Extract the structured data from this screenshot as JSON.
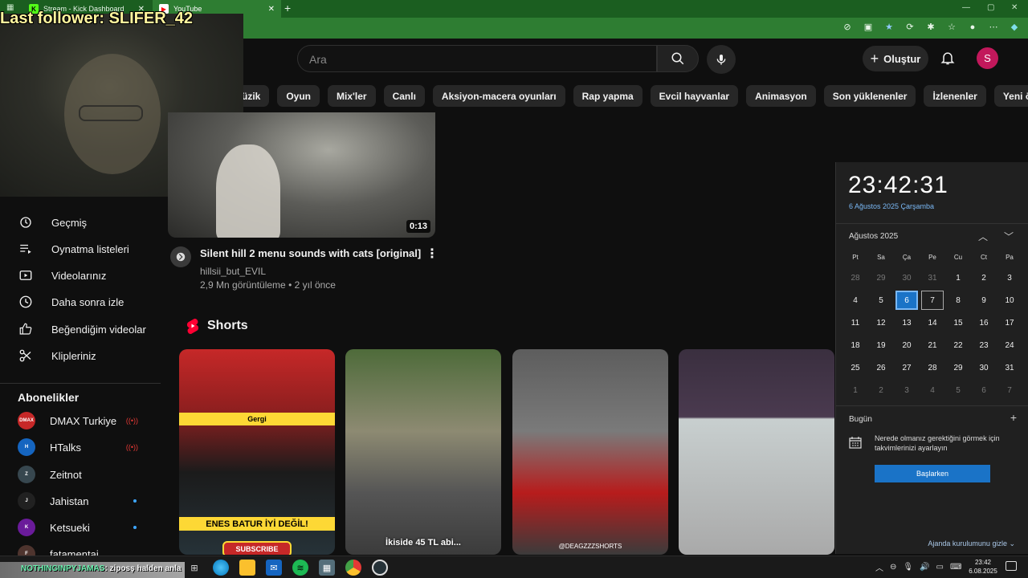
{
  "browser": {
    "tabs": [
      {
        "label": "Stream - Kick Dashboard",
        "favicon": "K",
        "favicon_color": "#53fc18"
      },
      {
        "label": "YouTube",
        "favicon": "▶",
        "favicon_color": "#ff0000"
      }
    ],
    "new_tab": "+",
    "window_controls": [
      "—",
      "▢",
      "✕"
    ]
  },
  "youtube": {
    "search_placeholder": "Ara",
    "create_label": "Oluştur",
    "avatar_letter": "S",
    "chips": [
      "üzik",
      "Oyun",
      "Mix'ler",
      "Canlı",
      "Aksiyon-macera oyunları",
      "Rap yapma",
      "Evcil hayvanlar",
      "Animasyon",
      "Son yüklenenler",
      "İzlenenler",
      "Yeni öneriler"
    ]
  },
  "overlay": {
    "last_follower": "Last follower: SLIFER_42"
  },
  "sidebar": {
    "items": [
      {
        "label": "Geçmiş",
        "icon": "history-icon"
      },
      {
        "label": "Oynatma listeleri",
        "icon": "playlist-icon"
      },
      {
        "label": "Videolarınız",
        "icon": "your-videos-icon"
      },
      {
        "label": "Daha sonra izle",
        "icon": "watch-later-icon"
      },
      {
        "label": "Beğendiğim videolar",
        "icon": "like-icon"
      },
      {
        "label": "Klipleriniz",
        "icon": "clips-icon"
      }
    ],
    "subs_heading": "Abonelikler",
    "subscriptions": [
      {
        "name": "DMAX Turkiye",
        "badge": "DMAX",
        "color": "#c62828",
        "status": "live"
      },
      {
        "name": "HTalks",
        "badge": "H",
        "color": "#1565c0",
        "status": "live"
      },
      {
        "name": "Zeitnot",
        "badge": "Z",
        "color": "#37474f",
        "status": "none"
      },
      {
        "name": "Jahistan",
        "badge": "J",
        "color": "#212121",
        "status": "new"
      },
      {
        "name": "Ketsueki",
        "badge": "K",
        "color": "#6a1b9a",
        "status": "new"
      },
      {
        "name": "fatamentai",
        "badge": "F",
        "color": "#4e342e",
        "status": "none"
      }
    ]
  },
  "video": {
    "duration": "0:13",
    "title": "Silent hill 2 menu sounds with cats [original]",
    "channel": "hillsii_but_EVIL",
    "meta": "2,9 Mn görüntüleme • 2 yıl önce"
  },
  "shorts": {
    "heading": "Shorts",
    "s1_band": "Gergi",
    "s1_caption": "ENES BATUR İYİ DEĞİL!",
    "s1_subscribe": "SUBSCRIBE",
    "s2_caption": "İkiside 45 TL abi...",
    "s3_caption": "@DEAGZZZSHORTS"
  },
  "calendar": {
    "time": "23:42:31",
    "date_long": "6 Ağustos 2025 Çarşamba",
    "month": "Ağustos 2025",
    "weekdays": [
      "Pt",
      "Sa",
      "Ça",
      "Pe",
      "Cu",
      "Ct",
      "Pa"
    ],
    "weeks": [
      [
        "28",
        "29",
        "30",
        "31",
        "1",
        "2",
        "3"
      ],
      [
        "4",
        "5",
        "6",
        "7",
        "8",
        "9",
        "10"
      ],
      [
        "11",
        "12",
        "13",
        "14",
        "15",
        "16",
        "17"
      ],
      [
        "18",
        "19",
        "20",
        "21",
        "22",
        "23",
        "24"
      ],
      [
        "25",
        "26",
        "27",
        "28",
        "29",
        "30",
        "31"
      ],
      [
        "1",
        "2",
        "3",
        "4",
        "5",
        "6",
        "7"
      ]
    ],
    "today_value": "6",
    "today_label": "Bugün",
    "message": "Nerede olmanız gerektiğini görmek için takvimlerinizi ayarlayın",
    "start_button": "Başlarken",
    "hide_agenda": "Ajanda kurulumunu gizle ⌄"
  },
  "taskbar": {
    "ticker_name": "NOTHINGINPYJAMAS",
    "ticker_msg": ": ziposş halden anla",
    "time": "23:42",
    "date": "6.08.2025"
  }
}
